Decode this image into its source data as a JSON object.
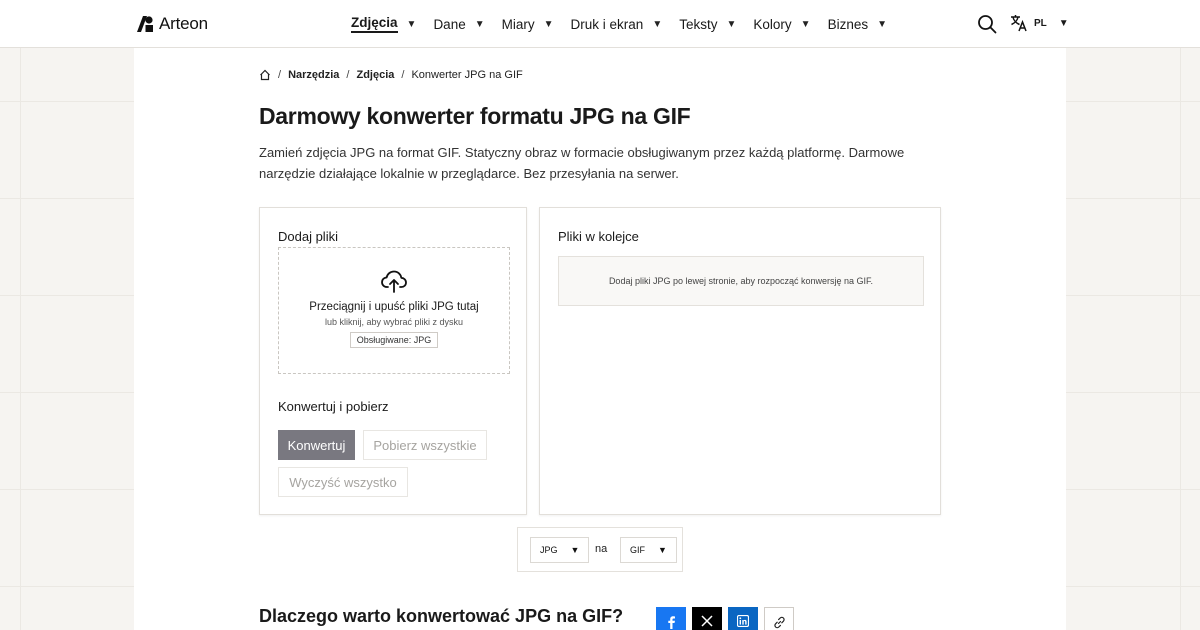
{
  "brand": {
    "name": "Arteon"
  },
  "nav": {
    "items": [
      {
        "label": "Zdjęcia",
        "active": true
      },
      {
        "label": "Dane"
      },
      {
        "label": "Miary"
      },
      {
        "label": "Druk i ekran"
      },
      {
        "label": "Teksty"
      },
      {
        "label": "Kolory"
      },
      {
        "label": "Biznes"
      }
    ]
  },
  "lang": {
    "code": "PL"
  },
  "breadcrumb": {
    "items": [
      "Narzędzia",
      "Zdjęcia",
      "Konwerter JPG na GIF"
    ]
  },
  "page": {
    "title": "Darmowy konwerter formatu JPG na GIF",
    "description": "Zamień zdjęcia JPG na format GIF. Statyczny obraz w formacie obsługiwanym przez każdą platformę. Darmowe narzędzie działające lokalnie w przeglądarce. Bez przesyłania na serwer."
  },
  "upload": {
    "heading": "Dodaj pliki",
    "drop_title": "Przeciągnij i upuść pliki JPG tutaj",
    "drop_sub": "lub kliknij, aby wybrać pliki z dysku",
    "supported": "Obsługiwane: JPG"
  },
  "actions": {
    "heading": "Konwertuj i pobierz",
    "convert": "Konwertuj",
    "download_all": "Pobierz wszystkie",
    "clear_all": "Wyczyść wszystko"
  },
  "queue": {
    "heading": "Pliki w kolejce",
    "empty": "Dodaj pliki JPG po lewej stronie, aby rozpocząć konwersję na GIF."
  },
  "converter": {
    "from": "JPG",
    "joiner": "na",
    "to": "GIF"
  },
  "section": {
    "title": "Dlaczego warto konwertować JPG na GIF?"
  },
  "colors": {
    "primary_button": "#797880",
    "facebook": "#1877f2",
    "x": "#000000",
    "linkedin": "#0a66c2"
  }
}
